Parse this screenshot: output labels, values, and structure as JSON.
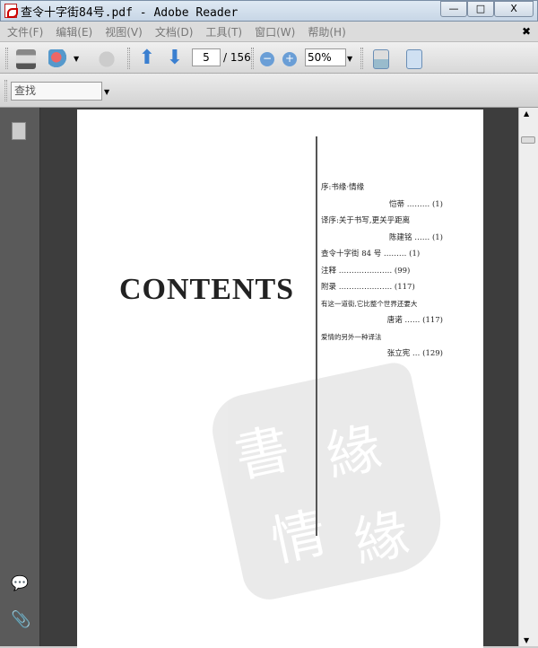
{
  "window": {
    "title": "查令十字街84号.pdf - Adobe Reader",
    "min": "—",
    "max": "□",
    "close": "X"
  },
  "menu": [
    "文件(F)",
    "编辑(E)",
    "视图(V)",
    "文档(D)",
    "工具(T)",
    "窗口(W)",
    "帮助(H)"
  ],
  "menu_close": "✖",
  "toolbar": {
    "page_current": "5",
    "page_total": "/ 156",
    "zoom": "50%"
  },
  "find": {
    "placeholder": "查找"
  },
  "page": {
    "heading": "CONTENTS",
    "toc": [
      {
        "text": "序:书缘·情缘",
        "right": ""
      },
      {
        "text": "",
        "right": "恺蒂 ……… (1)"
      },
      {
        "text": "译序:关于书写,更关乎距离",
        "right": ""
      },
      {
        "text": "",
        "right": "陈建铭 …… (1)"
      },
      {
        "text": "查令十字街 84 号 ……… (1)",
        "right": ""
      },
      {
        "text": "注释 ………………… (99)",
        "right": ""
      },
      {
        "text": "附录 ………………… (117)",
        "right": ""
      },
      {
        "text": "有这一道街,它比整个世界还要大",
        "right": ""
      },
      {
        "text": "",
        "right": "唐诺 …… (117)"
      },
      {
        "text": "爱情的另外一种译法",
        "right": ""
      },
      {
        "text": "",
        "right": "张立宪 … (129)"
      }
    ]
  }
}
